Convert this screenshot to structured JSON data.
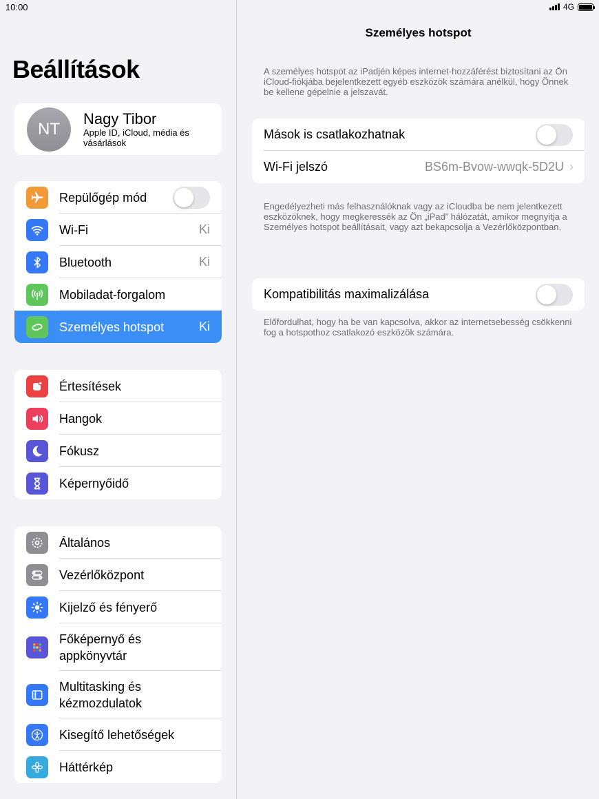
{
  "status_bar": {
    "time": "10:00",
    "network": "4G"
  },
  "sidebar": {
    "title": "Beállítások",
    "profile": {
      "initials": "NT",
      "name": "Nagy Tibor",
      "subtitle": "Apple ID, iCloud, média és vásárlások"
    },
    "group1": [
      {
        "label": "Repülőgép mód",
        "icon": "airplane-icon",
        "color": "#f19a37",
        "toggle": true
      },
      {
        "label": "Wi-Fi",
        "value": "Ki",
        "icon": "wifi-icon",
        "color": "#3478f6"
      },
      {
        "label": "Bluetooth",
        "value": "Ki",
        "icon": "bluetooth-icon",
        "color": "#3478f6"
      },
      {
        "label": "Mobiladat-forgalom",
        "icon": "antenna-icon",
        "color": "#5fc65b"
      },
      {
        "label": "Személyes hotspot",
        "value": "Ki",
        "icon": "hotspot-icon",
        "color": "#5fc65b",
        "selected": true
      }
    ],
    "group2": [
      {
        "label": "Értesítések",
        "icon": "notification-icon",
        "color": "#ec4141"
      },
      {
        "label": "Hangok",
        "icon": "speaker-icon",
        "color": "#ec3f5e"
      },
      {
        "label": "Fókusz",
        "icon": "moon-icon",
        "color": "#5856d6"
      },
      {
        "label": "Képernyőidő",
        "icon": "hourglass-icon",
        "color": "#5856d6"
      }
    ],
    "group3": [
      {
        "label": "Általános",
        "icon": "gear-icon",
        "color": "#8e8e93"
      },
      {
        "label": "Vezérlőközpont",
        "icon": "switches-icon",
        "color": "#8e8e93"
      },
      {
        "label": "Kijelző és fényerő",
        "icon": "sun-icon",
        "color": "#3478f6"
      },
      {
        "label": "Főképernyő és appkönyvtár",
        "icon": "grid-icon",
        "color": "#5856d6"
      },
      {
        "label": "Multitasking és kézmozdulatok",
        "icon": "multitasking-icon",
        "color": "#3478f6"
      },
      {
        "label": "Kisegítő lehetőségek",
        "icon": "accessibility-icon",
        "color": "#3478f6"
      },
      {
        "label": "Háttérkép",
        "icon": "flower-icon",
        "color": "#36aadc"
      }
    ]
  },
  "detail": {
    "title": "Személyes hotspot",
    "intro": "A személyes hotspot az iPadjén képes internet-hozzáférést biztosítani az Ön iCloud-fiókjába bejelentkezett egyéb eszközök számára anélkül, hogy Önnek be kellene gépelnie a jelszavát.",
    "allow_others_label": "Mások is csatlakozhatnak",
    "wifi_password_label": "Wi-Fi jelszó",
    "wifi_password_value": "BS6m-Bvow-wwqk-5D2U",
    "allow_note": "Engedélyezheti más felhasználóknak vagy az iCloudba be nem jelentkezett eszközöknek, hogy megkeressék az Ön „iPad” hálózatát, amikor megnyitja a Személyes hotspot beállításait, vagy azt bekapcsolja a Vezérlőközpontban.",
    "compat_label": "Kompatibilitás maximalizálása",
    "compat_note": "Előfordulhat, hogy ha be van kapcsolva, akkor az internetsebesség csökkenni fog a hotspothoz csatlakozó eszközök számára."
  }
}
